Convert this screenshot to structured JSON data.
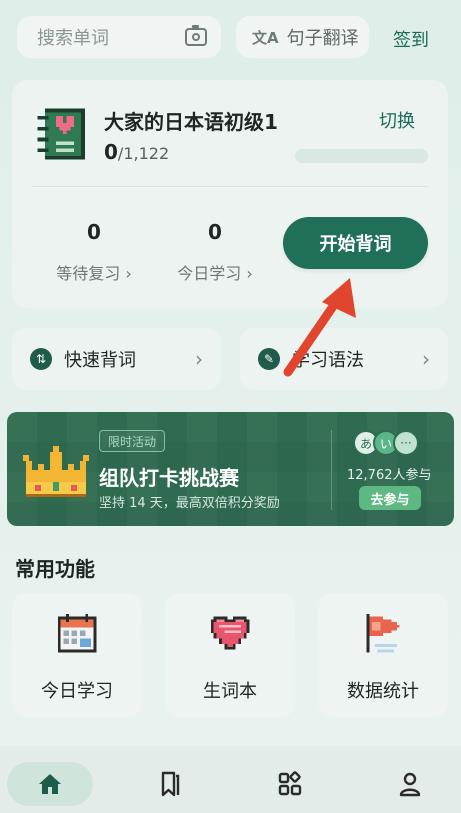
{
  "top_bar": {
    "search_placeholder": "搜索单词",
    "translate_label": "句子翻译",
    "translate_icon": "translate-icon",
    "checkin_label": "签到"
  },
  "book": {
    "title": "大家的日本语初级1",
    "switch_label": "切换",
    "learned": "0",
    "total": "/1,122",
    "progress": 0
  },
  "stats": [
    {
      "value": "0",
      "label": "等待复习 ›"
    },
    {
      "value": "0",
      "label": "今日学习 ›"
    }
  ],
  "start_button": "开始背词",
  "quick_actions": [
    {
      "label": "快速背词",
      "icon": "refresh-icon"
    },
    {
      "label": "学习语法",
      "icon": "wrench-icon"
    }
  ],
  "banner": {
    "tag": "限时活动",
    "title": "组队打卡挑战赛",
    "subtitle": "坚持 14 天，最高双倍积分奖励",
    "avatars": [
      "あ",
      "い",
      "···"
    ],
    "participants": "12,762人参与",
    "join_label": "去参与"
  },
  "section_title": "常用功能",
  "features": [
    {
      "label": "今日学习",
      "icon": "calendar-icon"
    },
    {
      "label": "生词本",
      "icon": "heart-icon"
    },
    {
      "label": "数据统计",
      "icon": "flag-icon"
    }
  ],
  "tabs": [
    "home-icon",
    "bookmark-icon",
    "apps-icon",
    "profile-icon"
  ],
  "colors": {
    "accent": "#1f6f59",
    "banner_bg": "#2f6b50",
    "join_button": "#5db881"
  }
}
